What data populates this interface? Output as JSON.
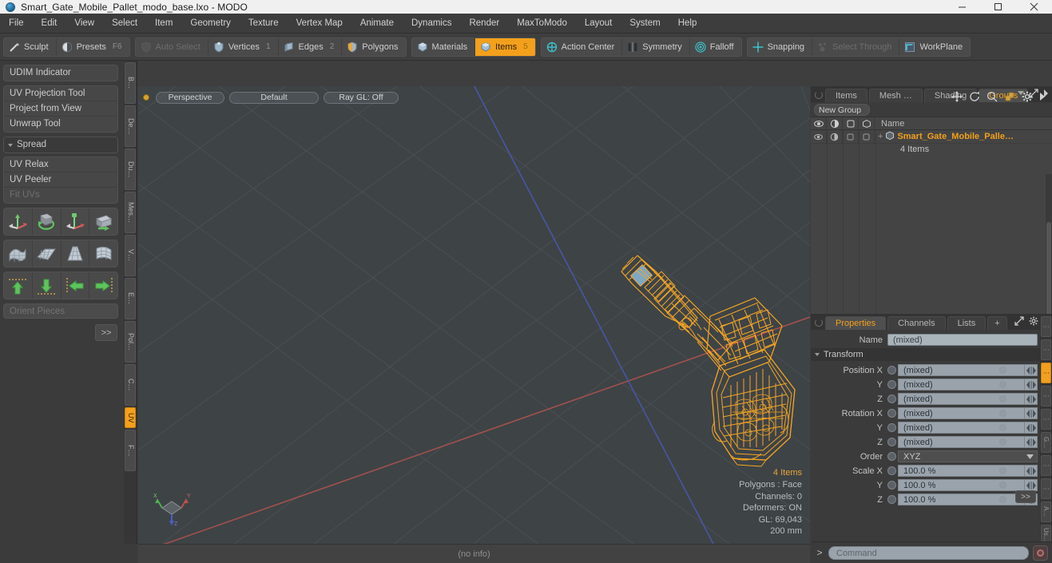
{
  "window": {
    "title": "Smart_Gate_Mobile_Pallet_modo_base.lxo - MODO",
    "app_icon": "modo-sphere-icon",
    "minimize": "minimize-icon",
    "maximize": "maximize-icon",
    "close": "close-icon"
  },
  "menubar": {
    "items": [
      "File",
      "Edit",
      "View",
      "Select",
      "Item",
      "Geometry",
      "Texture",
      "Vertex Map",
      "Animate",
      "Dynamics",
      "Render",
      "MaxToModo",
      "Layout",
      "System",
      "Help"
    ]
  },
  "toolbar": {
    "group1": [
      {
        "label": "Sculpt",
        "icon": "sculpt-brush-icon",
        "state": "normal",
        "num": ""
      },
      {
        "label": "Presets",
        "icon": "presets-sphere-icon",
        "state": "normal",
        "num": "F6"
      }
    ],
    "group2": [
      {
        "label": "Auto Select",
        "icon": "shield-icon",
        "state": "disabled",
        "num": ""
      },
      {
        "label": "Vertices",
        "icon": "vertices-icon",
        "state": "normal",
        "num": "1"
      },
      {
        "label": "Edges",
        "icon": "edges-icon",
        "state": "normal",
        "num": "2"
      },
      {
        "label": "Polygons",
        "icon": "polygons-icon",
        "state": "normal",
        "num": ""
      }
    ],
    "group3": [
      {
        "label": "Materials",
        "icon": "materials-cube-icon",
        "state": "normal",
        "num": ""
      },
      {
        "label": "Items",
        "icon": "items-cube-icon",
        "state": "active",
        "num": "5"
      }
    ],
    "group4": [
      {
        "label": "Action Center",
        "icon": "action-center-icon",
        "state": "normal",
        "num": ""
      },
      {
        "label": "Symmetry",
        "icon": "symmetry-icon",
        "state": "normal",
        "num": ""
      },
      {
        "label": "Falloff",
        "icon": "falloff-icon",
        "state": "normal",
        "num": ""
      }
    ],
    "group5": [
      {
        "label": "Snapping",
        "icon": "snapping-icon",
        "state": "normal",
        "num": ""
      },
      {
        "label": "Select Through",
        "icon": "select-through-icon",
        "state": "disabled",
        "num": ""
      },
      {
        "label": "WorkPlane",
        "icon": "workplane-icon",
        "state": "normal",
        "num": ""
      }
    ]
  },
  "left_panel": {
    "block1": [
      {
        "label": "UDIM Indicator",
        "state": "normal"
      }
    ],
    "block2": [
      {
        "label": "UV Projection Tool",
        "state": "normal"
      },
      {
        "label": "Project from View",
        "state": "normal"
      },
      {
        "label": "Unwrap Tool",
        "state": "normal"
      }
    ],
    "section_header": "Spread",
    "block3": [
      {
        "label": "UV Relax",
        "state": "normal"
      },
      {
        "label": "UV Peeler",
        "state": "normal"
      },
      {
        "label": "Fit UVs",
        "state": "disabled"
      }
    ],
    "icon_rows": [
      [
        "move-axis-icon",
        "rotate-cube-icon",
        "scale-axis-icon",
        "shear-cube-icon"
      ],
      [
        "smooth-mesh-icon",
        "grid-flatten-icon",
        "taper-mesh-icon",
        "bend-mesh-icon"
      ],
      [
        "align-up-icon",
        "align-down-icon",
        "align-left-icon",
        "align-right-icon"
      ]
    ],
    "orient_placeholder": "Orient Pieces",
    "expand_button": ">>",
    "vtabs": [
      {
        "label": "B…",
        "active": false
      },
      {
        "label": "De…",
        "active": false
      },
      {
        "label": "Du…",
        "active": false
      },
      {
        "label": "Mes…",
        "active": false
      },
      {
        "label": "V…",
        "active": false
      },
      {
        "label": "E…",
        "active": false
      },
      {
        "label": "Pol…",
        "active": false
      },
      {
        "label": "C…",
        "active": false
      },
      {
        "label": "UV",
        "active": true
      },
      {
        "label": "F…",
        "active": false
      }
    ]
  },
  "viewport": {
    "buttons": [
      "Perspective",
      "Default",
      "Ray GL: Off"
    ],
    "nav_icons": [
      "pan-icon",
      "rotate-icon",
      "zoom-magnifier-icon",
      "fit-view-icon",
      "viewport-settings-gear-icon",
      "more-arrow-icon"
    ],
    "info": {
      "items": "4 Items",
      "polygons": "Polygons : Face",
      "channels": "Channels: 0",
      "deformers": "Deformers: ON",
      "gl": "GL: 69,043",
      "grid": "200 mm"
    },
    "gizmo": {
      "x": "X",
      "y": "Y",
      "z": "Z"
    },
    "footer_status": "(no info)",
    "colors": {
      "background": "#3e4346",
      "wireframe": "#f5a623",
      "x_axis": "#b2544d",
      "z_axis": "#4a5fb4"
    }
  },
  "right_panel": {
    "top_tabs": [
      {
        "label": "Items",
        "active": false
      },
      {
        "label": "Mesh …",
        "active": false
      },
      {
        "label": "Shading",
        "active": false
      },
      {
        "label": "Groups",
        "active": true
      }
    ],
    "top_tab_icons": [
      "chevron-down-icon",
      "expand-panel-icon",
      "panel-menu-arrow-icon"
    ],
    "new_group_button": "New Group",
    "list_columns": [
      "eye-visibility-icon",
      "render-icon",
      "wireframe-icon",
      "shading-icon"
    ],
    "list_name_header": "Name",
    "list_rows": [
      {
        "name": "Smart_Gate_Mobile_Palle…",
        "icon": "group-item-icon",
        "expander": "+",
        "sub_label": "4 Items"
      }
    ],
    "properties": {
      "tabs": [
        {
          "label": "Properties",
          "active": true
        },
        {
          "label": "Channels",
          "active": false
        },
        {
          "label": "Lists",
          "active": false
        },
        {
          "label": "+",
          "active": false
        }
      ],
      "tab_icons": [
        "expand-panel-icon",
        "gear-icon",
        "panel-menu-arrow-icon"
      ],
      "name_label": "Name",
      "name_value": "(mixed)",
      "transform_header": "Transform",
      "fields": [
        {
          "label": "Position X",
          "value": "(mixed)",
          "type": "numeric"
        },
        {
          "label": "Y",
          "value": "(mixed)",
          "type": "numeric"
        },
        {
          "label": "Z",
          "value": "(mixed)",
          "type": "numeric"
        },
        {
          "label": "Rotation X",
          "value": "(mixed)",
          "type": "numeric"
        },
        {
          "label": "Y",
          "value": "(mixed)",
          "type": "numeric"
        },
        {
          "label": "Z",
          "value": "(mixed)",
          "type": "numeric"
        },
        {
          "label": "Order",
          "value": "XYZ",
          "type": "dropdown"
        },
        {
          "label": "Scale X",
          "value": "100.0 %",
          "type": "numeric"
        },
        {
          "label": "Y",
          "value": "100.0 %",
          "type": "numeric"
        },
        {
          "label": "Z",
          "value": "100.0 %",
          "type": "numeric"
        }
      ],
      "expand_button": ">>"
    },
    "vtabs": [
      {
        "label": "⋮",
        "active": false
      },
      {
        "label": "⋮",
        "active": false
      },
      {
        "label": "⋮",
        "active": true
      },
      {
        "label": "⋮",
        "active": false
      },
      {
        "label": "⋮",
        "active": false
      },
      {
        "label": "G…",
        "active": false
      },
      {
        "label": "⋮",
        "active": false
      },
      {
        "label": "⋮",
        "active": false
      },
      {
        "label": "A…",
        "active": false
      },
      {
        "label": "Us…",
        "active": false
      },
      {
        "label": "⋮",
        "active": false
      }
    ]
  },
  "command_bar": {
    "prompt": ">",
    "placeholder": "Command",
    "record_button": "record-macro-icon"
  }
}
